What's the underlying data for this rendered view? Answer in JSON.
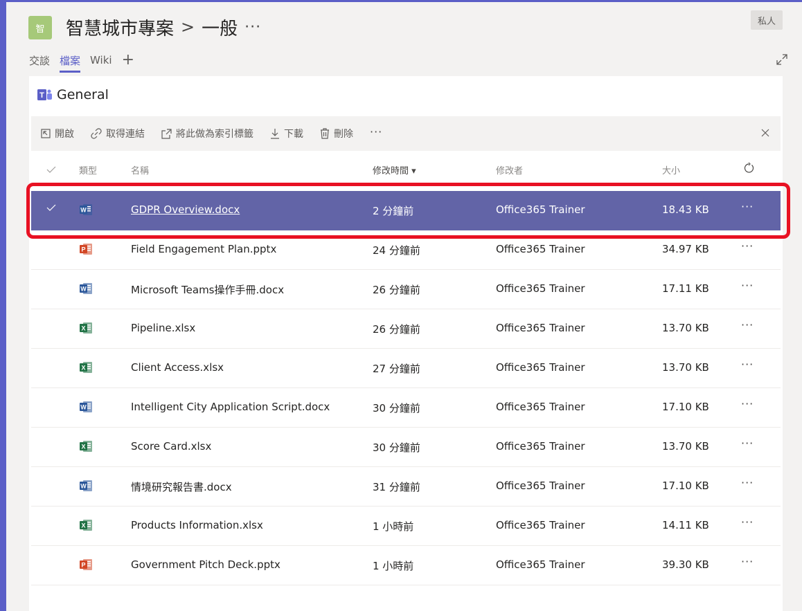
{
  "header": {
    "team_avatar_text": "智",
    "team_name": "智慧城市專案",
    "separator": ">",
    "channel_name": "一般",
    "more": "···",
    "private_label": "私人"
  },
  "tabs": [
    {
      "label": "交談",
      "active": false
    },
    {
      "label": "檔案",
      "active": true
    },
    {
      "label": "Wiki",
      "active": false
    }
  ],
  "add_tab_label": "+",
  "library": {
    "title": "General"
  },
  "command_bar": {
    "open": "開啟",
    "get_link": "取得連結",
    "make_tab": "將此做為索引標籤",
    "download": "下載",
    "delete": "刪除",
    "more": "···"
  },
  "columns": {
    "type": "類型",
    "name": "名稱",
    "modified": "修改時間 ▾",
    "modified_by": "修改者",
    "size": "大小"
  },
  "files": [
    {
      "type": "word",
      "name": "GDPR Overview.docx",
      "modified": "2 分鐘前",
      "modified_by": "Office365 Trainer",
      "size": "18.43 KB",
      "selected": true
    },
    {
      "type": "powerpoint",
      "name": "Field Engagement Plan.pptx",
      "modified": "24 分鐘前",
      "modified_by": "Office365 Trainer",
      "size": "34.97 KB"
    },
    {
      "type": "word",
      "name": "Microsoft Teams操作手冊.docx",
      "modified": "26 分鐘前",
      "modified_by": "Office365 Trainer",
      "size": "17.11 KB"
    },
    {
      "type": "excel",
      "name": "Pipeline.xlsx",
      "modified": "26 分鐘前",
      "modified_by": "Office365 Trainer",
      "size": "13.70 KB"
    },
    {
      "type": "excel",
      "name": "Client Access.xlsx",
      "modified": "27 分鐘前",
      "modified_by": "Office365 Trainer",
      "size": "13.70 KB"
    },
    {
      "type": "word",
      "name": "Intelligent City Application Script.docx",
      "modified": "30 分鐘前",
      "modified_by": "Office365 Trainer",
      "size": "17.10 KB"
    },
    {
      "type": "excel",
      "name": "Score Card.xlsx",
      "modified": "30 分鐘前",
      "modified_by": "Office365 Trainer",
      "size": "13.70 KB"
    },
    {
      "type": "word",
      "name": "情境研究報告書.docx",
      "modified": "31 分鐘前",
      "modified_by": "Office365 Trainer",
      "size": "17.10 KB"
    },
    {
      "type": "excel",
      "name": "Products Information.xlsx",
      "modified": "1 小時前",
      "modified_by": "Office365 Trainer",
      "size": "14.11 KB"
    },
    {
      "type": "powerpoint",
      "name": "Government Pitch Deck.pptx",
      "modified": "1 小時前",
      "modified_by": "Office365 Trainer",
      "size": "39.30 KB"
    }
  ],
  "row_more": "···",
  "colors": {
    "accent": "#6264a7",
    "highlight": "#e81123",
    "word": "#2b579a",
    "excel": "#217346",
    "powerpoint": "#d24726"
  }
}
